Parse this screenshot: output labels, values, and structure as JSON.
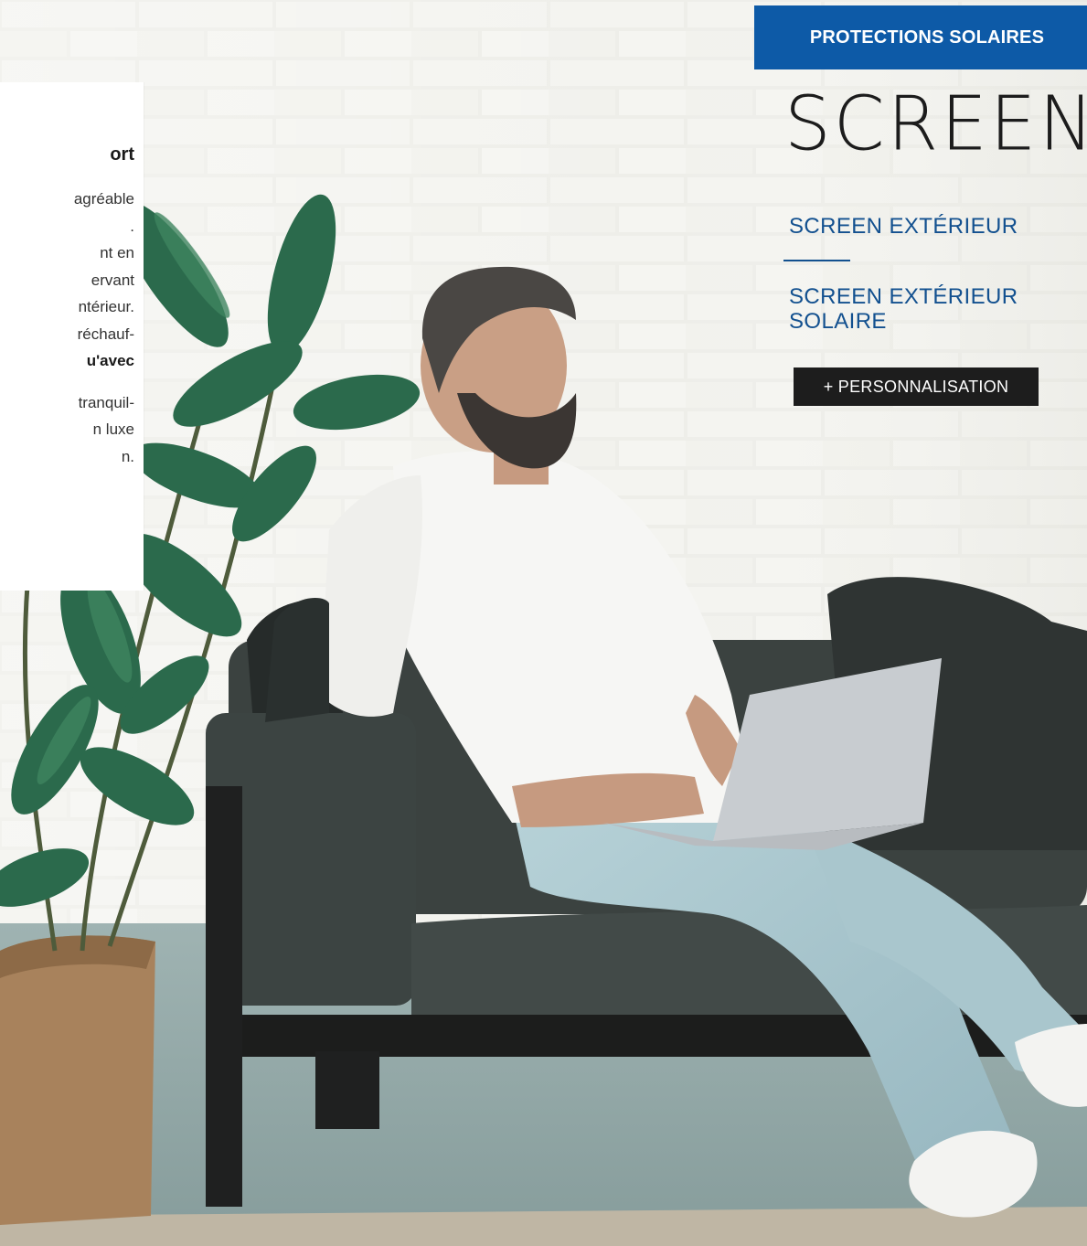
{
  "category_badge": "PROTECTIONS SOLAIRES",
  "title": "SCREEN",
  "nav": {
    "link_1": "SCREEN EXTÉRIEUR",
    "link_2": "SCREEN EXTÉRIEUR SOLAIRE"
  },
  "personalize_button": "+ PERSONNALISATION",
  "text_panel": {
    "heading": "ort",
    "lines": [
      "agréable",
      ".",
      "nt en",
      "ervant",
      "ntérieur.",
      "réchauf-",
      "u'avec",
      "tranquil-",
      "n luxe",
      "n."
    ]
  },
  "colors": {
    "brand_blue": "#0d5aa7",
    "link_blue": "#12508f",
    "button_dark": "#1d1d1d"
  }
}
